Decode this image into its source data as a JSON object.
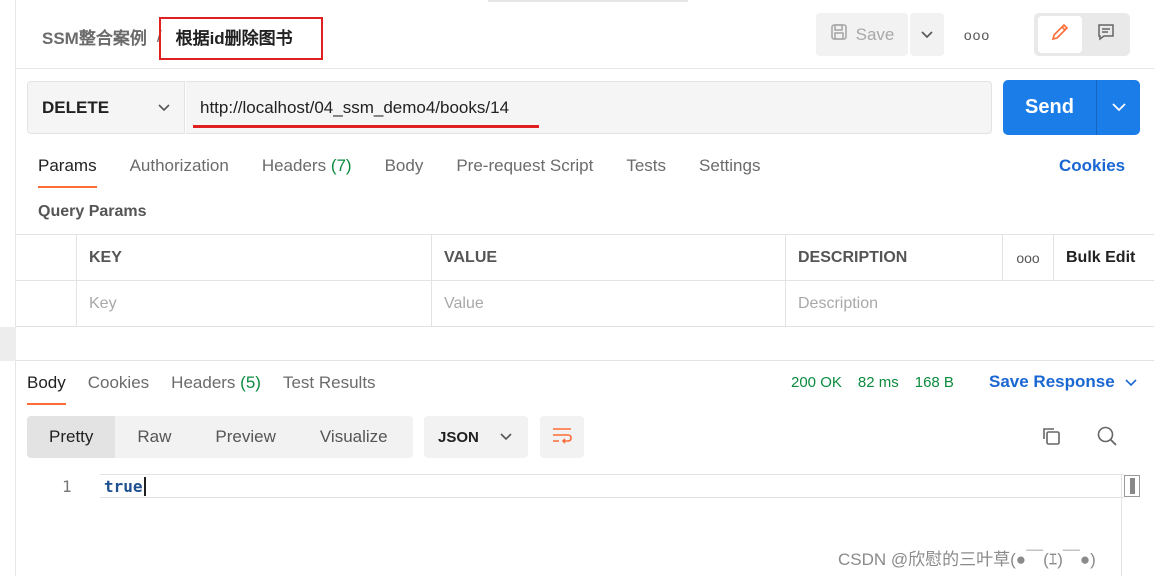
{
  "header": {
    "collection": "SSM整合案例",
    "separator": "/",
    "request_name": "根据id删除图书",
    "save_label": "Save",
    "more": "ooo"
  },
  "request": {
    "method": "DELETE",
    "url": "http://localhost/04_ssm_demo4/books/14",
    "send_label": "Send"
  },
  "request_tabs": [
    {
      "label": "Params",
      "count": ""
    },
    {
      "label": "Authorization",
      "count": ""
    },
    {
      "label": "Headers",
      "count": "(7)"
    },
    {
      "label": "Body",
      "count": ""
    },
    {
      "label": "Pre-request Script",
      "count": ""
    },
    {
      "label": "Tests",
      "count": ""
    },
    {
      "label": "Settings",
      "count": ""
    }
  ],
  "cookies_link": "Cookies",
  "query_params": {
    "title": "Query Params",
    "columns": [
      "KEY",
      "VALUE",
      "DESCRIPTION"
    ],
    "more": "ooo",
    "bulk_edit": "Bulk Edit",
    "placeholders": [
      "Key",
      "Value",
      "Description"
    ]
  },
  "response": {
    "tabs": [
      {
        "label": "Body",
        "count": ""
      },
      {
        "label": "Cookies",
        "count": ""
      },
      {
        "label": "Headers",
        "count": "(5)"
      },
      {
        "label": "Test Results",
        "count": ""
      }
    ],
    "status": "200 OK",
    "time": "82 ms",
    "size": "168 B",
    "save_response": "Save Response",
    "views": [
      "Pretty",
      "Raw",
      "Preview",
      "Visualize"
    ],
    "format": "JSON",
    "line_number": "1",
    "body": "true"
  },
  "watermark": "CSDN @欣慰的三叶草(●￣(ｴ)￣●)",
  "colors": {
    "accent": "#ff6c37",
    "send": "#1a7de8",
    "link": "#1a67d4",
    "success": "#0c8a3e",
    "highlight": "#e02020"
  }
}
